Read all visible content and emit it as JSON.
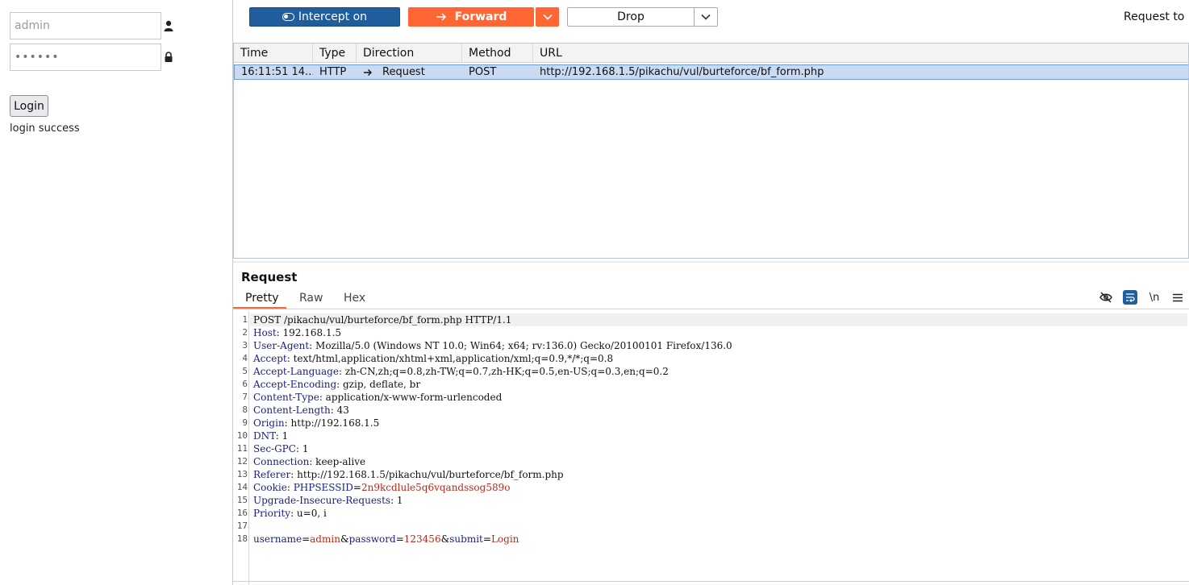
{
  "browser": {
    "username_value": "admin",
    "password_value": "••••••",
    "login_label": "Login",
    "message": "login success"
  },
  "toolbar": {
    "intercept_label": "Intercept on",
    "forward_label": "Forward",
    "drop_label": "Drop",
    "request_to": "Request to ht"
  },
  "table": {
    "columns": [
      "Time",
      "Type",
      "Direction",
      "Method",
      "URL"
    ],
    "rows": [
      {
        "time": "16:11:51 14...",
        "type": "HTTP",
        "direction": "Request",
        "method": "POST",
        "url": "http://192.168.1.5/pikachu/vul/burteforce/bf_form.php"
      }
    ]
  },
  "request": {
    "title": "Request",
    "tabs": [
      "Pretty",
      "Raw",
      "Hex"
    ],
    "newline_label": "\\n",
    "request_line": "POST /pikachu/vul/burteforce/bf_form.php HTTP/1.1",
    "headers": [
      {
        "key": "Host",
        "value": "192.168.1.5"
      },
      {
        "key": "User-Agent",
        "value": "Mozilla/5.0 (Windows NT 10.0; Win64; x64; rv:136.0) Gecko/20100101 Firefox/136.0"
      },
      {
        "key": "Accept",
        "value": "text/html,application/xhtml+xml,application/xml;q=0.9,*/*;q=0.8"
      },
      {
        "key": "Accept-Language",
        "value": "zh-CN,zh;q=0.8,zh-TW;q=0.7,zh-HK;q=0.5,en-US;q=0.3,en;q=0.2"
      },
      {
        "key": "Accept-Encoding",
        "value": "gzip, deflate, br"
      },
      {
        "key": "Content-Type",
        "value": "application/x-www-form-urlencoded"
      },
      {
        "key": "Content-Length",
        "value": "43"
      },
      {
        "key": "Origin",
        "value": "http://192.168.1.5"
      },
      {
        "key": "DNT",
        "value": "1"
      },
      {
        "key": "Sec-GPC",
        "value": "1"
      },
      {
        "key": "Connection",
        "value": "keep-alive"
      },
      {
        "key": "Referer",
        "value": "http://192.168.1.5/pikachu/vul/burteforce/bf_form.php"
      },
      {
        "key": "Cookie",
        "value": ""
      },
      {
        "key": "Upgrade-Insecure-Requests",
        "value": "1"
      },
      {
        "key": "Priority",
        "value": "u=0, i"
      }
    ],
    "cookie": {
      "name": "PHPSESSID",
      "value": "2n9kcdlule5q6vqandssog589o"
    },
    "body": [
      {
        "name": "username",
        "value": "admin"
      },
      {
        "name": "password",
        "value": "123456"
      },
      {
        "name": "submit",
        "value": "Login"
      }
    ]
  },
  "colors": {
    "intercept_blue": "#1f5d9c",
    "forward_orange": "#ff6633",
    "row_selected": "#c9daf2",
    "param_value_red": "#b52a1d"
  }
}
